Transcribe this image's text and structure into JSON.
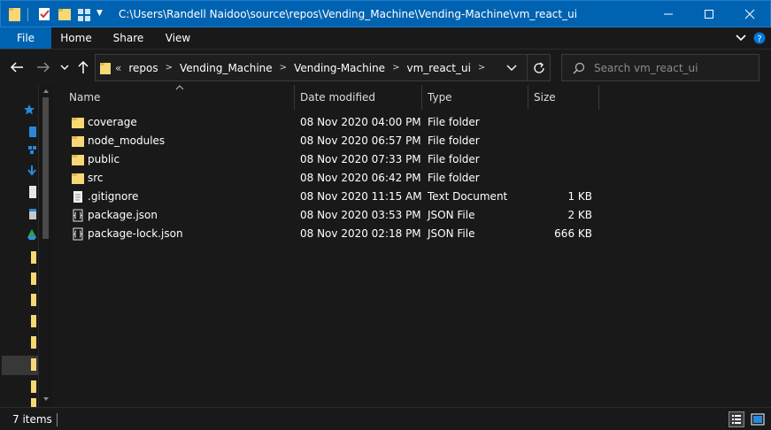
{
  "window": {
    "title": "C:\\Users\\Randell Naidoo\\source\\repos\\Vending_Machine\\Vending-Machine\\vm_react_ui"
  },
  "ribbon": {
    "tabs": [
      {
        "label": "File"
      },
      {
        "label": "Home"
      },
      {
        "label": "Share"
      },
      {
        "label": "View"
      }
    ]
  },
  "address": {
    "overflow": "«",
    "crumbs": [
      "repos",
      "Vending_Machine",
      "Vending-Machine",
      "vm_react_ui"
    ]
  },
  "search": {
    "placeholder": "Search vm_react_ui"
  },
  "columns": {
    "name": "Name",
    "date": "Date modified",
    "type": "Type",
    "size": "Size"
  },
  "files": [
    {
      "name": "coverage",
      "date": "08 Nov 2020 04:00 PM",
      "type": "File folder",
      "size": "",
      "icon": "folder-icon"
    },
    {
      "name": "node_modules",
      "date": "08 Nov 2020 06:57 PM",
      "type": "File folder",
      "size": "",
      "icon": "folder-icon"
    },
    {
      "name": "public",
      "date": "08 Nov 2020 07:33 PM",
      "type": "File folder",
      "size": "",
      "icon": "folder-icon"
    },
    {
      "name": "src",
      "date": "08 Nov 2020 06:42 PM",
      "type": "File folder",
      "size": "",
      "icon": "folder-icon"
    },
    {
      "name": ".gitignore",
      "date": "08 Nov 2020 11:15 AM",
      "type": "Text Document",
      "size": "1 KB",
      "icon": "text-file-icon"
    },
    {
      "name": "package.json",
      "date": "08 Nov 2020 03:53 PM",
      "type": "JSON File",
      "size": "2 KB",
      "icon": "json-file-icon"
    },
    {
      "name": "package-lock.json",
      "date": "08 Nov 2020 02:18 PM",
      "type": "JSON File",
      "size": "666 KB",
      "icon": "json-file-icon"
    }
  ],
  "status": {
    "item_count": "7 items"
  },
  "colors": {
    "accent": "#0063b1",
    "background": "#191919",
    "folder": "#f8d775"
  }
}
